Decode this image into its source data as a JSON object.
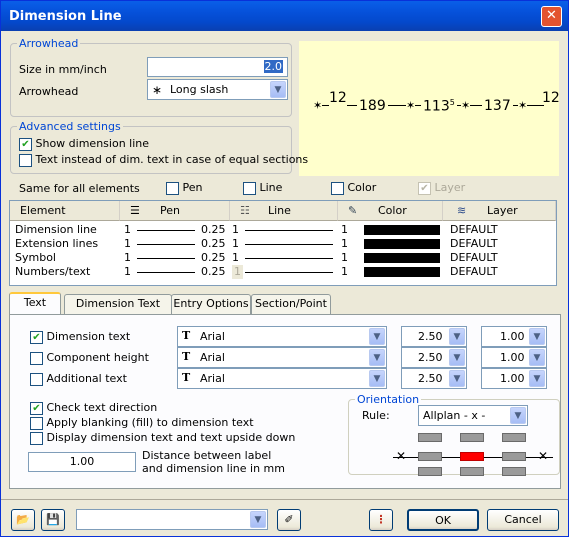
{
  "window": {
    "title": "Dimension Line"
  },
  "arrowhead": {
    "group_title": "Arrowhead",
    "size_label": "Size in mm/inch",
    "size_value": "2.0",
    "arrowhead_label": "Arrowhead",
    "arrowhead_value": "Long slash",
    "arrowhead_glyph": "∗"
  },
  "preview": {
    "text_12a": "12",
    "text_189": "189",
    "text_113": "113",
    "text_113_sup": "5",
    "text_137": "137",
    "text_12b": "12"
  },
  "advanced": {
    "group_title": "Advanced settings",
    "show_dim_line": "Show dimension line",
    "text_instead": "Text instead of dim. text in case of equal sections"
  },
  "same_for_all": {
    "label": "Same for all elements",
    "pen": "Pen",
    "line": "Line",
    "color": "Color",
    "layer": "Layer"
  },
  "grid": {
    "headers": {
      "element": "Element",
      "pen": "Pen",
      "line": "Line",
      "color": "Color",
      "layer": "Layer"
    },
    "rows": [
      {
        "element": "Dimension line",
        "pen_a": "1",
        "pen_b": "0.25",
        "line_a": "1",
        "line_b": "1",
        "layer": "DEFAULT"
      },
      {
        "element": "Extension lines",
        "pen_a": "1",
        "pen_b": "0.25",
        "line_a": "1",
        "line_b": "1",
        "layer": "DEFAULT"
      },
      {
        "element": "Symbol",
        "pen_a": "1",
        "pen_b": "0.25",
        "line_a": "1",
        "line_b": "1",
        "layer": "DEFAULT"
      },
      {
        "element": "Numbers/text",
        "pen_a": "1",
        "pen_b": "0.25",
        "line_a": "1",
        "line_b": "1",
        "layer": "DEFAULT"
      }
    ]
  },
  "tabs": [
    "Text",
    "Dimension Text",
    "Entry Options",
    "Section/Point"
  ],
  "text_tab": {
    "rows": [
      {
        "label": "Dimension text",
        "checked": true,
        "font": "Arial",
        "size": "2.50",
        "ratio": "1.00"
      },
      {
        "label": "Component height",
        "checked": false,
        "font": "Arial",
        "size": "2.50",
        "ratio": "1.00"
      },
      {
        "label": "Additional text",
        "checked": false,
        "font": "Arial",
        "size": "2.50",
        "ratio": "1.00"
      }
    ],
    "font_glyph": "T",
    "check_direction": "Check text direction",
    "apply_blanking": "Apply blanking (fill) to dimension text",
    "display_upside": "Display dimension text and text upside down",
    "distance_value": "1.00",
    "distance_label_1": "Distance between label",
    "distance_label_2": "and dimension line in mm",
    "orientation_title": "Orientation",
    "rule_label": "Rule:",
    "rule_value": "Allplan  - x -"
  },
  "bottom": {
    "ok": "OK",
    "cancel": "Cancel"
  },
  "colors": {
    "accent": "#0046d5",
    "preview_bg": "#ffffcc",
    "highlight": "#ff0000"
  }
}
